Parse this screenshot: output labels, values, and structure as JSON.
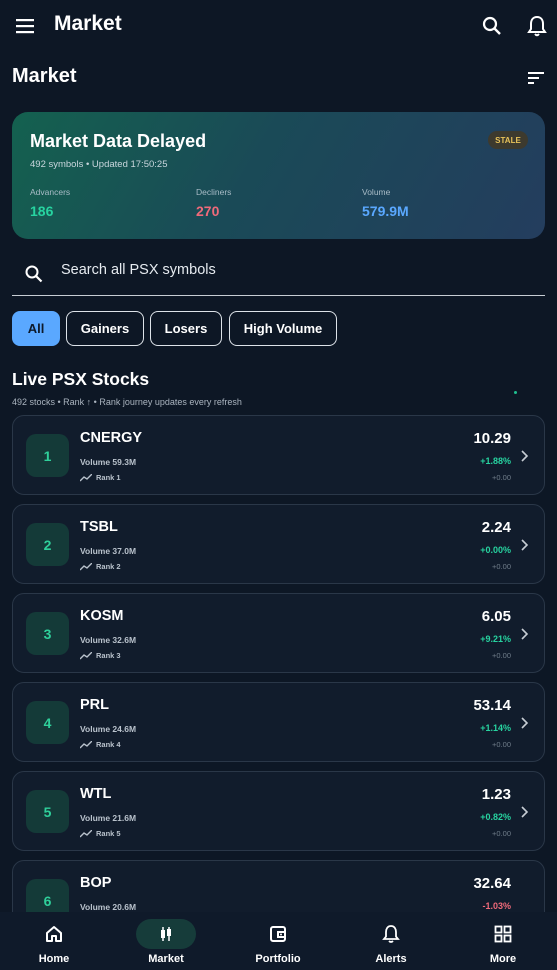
{
  "app_bar": {
    "title": "Market"
  },
  "page": {
    "title": "Market"
  },
  "summary": {
    "title": "Market Data Delayed",
    "subtitle": "492 symbols • Updated 17:50:25",
    "badge": "STALE",
    "advancers_label": "Advancers",
    "advancers_value": "186",
    "decliners_label": "Decliners",
    "decliners_value": "270",
    "volume_label": "Volume",
    "volume_value": "579.9M",
    "colors": {
      "advancers": "#27d3a0",
      "decliners": "#f06a7a",
      "volume": "#5aa8ff"
    }
  },
  "search": {
    "placeholder": "Search all PSX symbols"
  },
  "filters": [
    "All",
    "Gainers",
    "Losers",
    "High Volume"
  ],
  "active_filter": "All",
  "list": {
    "title": "Live PSX Stocks",
    "subtitle": "492 stocks • Rank ↑ • Rank journey updates every refresh",
    "rows": [
      {
        "rank": "1",
        "symbol": "CNERGY",
        "volume": "Volume 59.3M",
        "rank_label": "Rank 1",
        "price": "10.29",
        "pct": "+1.88%",
        "change": "+0.00",
        "direction": "up"
      },
      {
        "rank": "2",
        "symbol": "TSBL",
        "volume": "Volume 37.0M",
        "rank_label": "Rank 2",
        "price": "2.24",
        "pct": "+0.00%",
        "change": "+0.00",
        "direction": "up"
      },
      {
        "rank": "3",
        "symbol": "KOSM",
        "volume": "Volume 32.6M",
        "rank_label": "Rank 3",
        "price": "6.05",
        "pct": "+9.21%",
        "change": "+0.00",
        "direction": "up"
      },
      {
        "rank": "4",
        "symbol": "PRL",
        "volume": "Volume 24.6M",
        "rank_label": "Rank 4",
        "price": "53.14",
        "pct": "+1.14%",
        "change": "+0.00",
        "direction": "up"
      },
      {
        "rank": "5",
        "symbol": "WTL",
        "volume": "Volume 21.6M",
        "rank_label": "Rank 5",
        "price": "1.23",
        "pct": "+0.82%",
        "change": "+0.00",
        "direction": "up"
      },
      {
        "rank": "6",
        "symbol": "BOP",
        "volume": "Volume 20.6M",
        "rank_label": "",
        "price": "32.64",
        "pct": "-1.03%",
        "change": "",
        "direction": "down"
      }
    ]
  },
  "bottom_nav": [
    {
      "label": "Home",
      "icon": "home-icon"
    },
    {
      "label": "Market",
      "icon": "candlestick-icon",
      "active": true
    },
    {
      "label": "Portfolio",
      "icon": "wallet-icon"
    },
    {
      "label": "Alerts",
      "icon": "bell-icon"
    },
    {
      "label": "More",
      "icon": "grid-icon"
    }
  ],
  "colors": {
    "up": "#27d3a0",
    "down": "#f06a7a",
    "accent": "#5aa8ff"
  }
}
